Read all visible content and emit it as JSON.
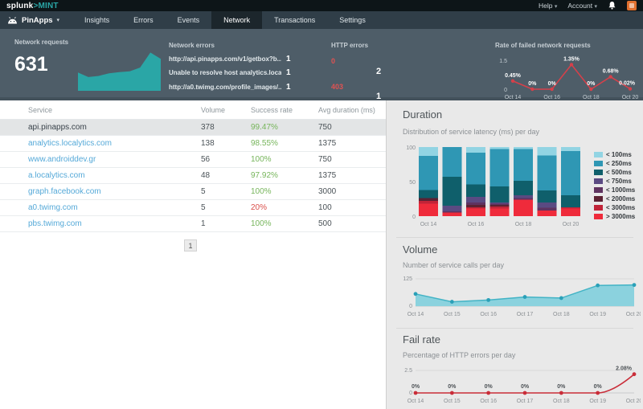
{
  "topbar": {
    "logo_splunk": "splunk",
    "logo_gt": ">",
    "logo_mint": "MINT",
    "help_label": "Help",
    "account_label": "Account"
  },
  "icons": {
    "caret": "▾"
  },
  "nav": {
    "app_label": "PinApps",
    "tabs": [
      {
        "label": "Insights",
        "active": false
      },
      {
        "label": "Errors",
        "active": false
      },
      {
        "label": "Events",
        "active": false
      },
      {
        "label": "Network",
        "active": true
      },
      {
        "label": "Transactions",
        "active": false
      },
      {
        "label": "Settings",
        "active": false
      }
    ]
  },
  "summary": {
    "network_requests": {
      "label": "Network requests",
      "value": "631"
    },
    "network_errors": {
      "label": "Network errors",
      "items": [
        {
          "text": "http://api.pinapps.com/v1/getbox?b...",
          "count": "1"
        },
        {
          "text": "Unable to resolve host analytics.local...",
          "count": "1"
        },
        {
          "text": "http://a0.twimg.com/profile_images/...",
          "count": "1"
        }
      ]
    },
    "http_errors": {
      "label": "HTTP errors",
      "items": [
        {
          "code": "0",
          "count": "2"
        },
        {
          "code": "403",
          "count": "1"
        }
      ]
    },
    "fail_rate_label": "Rate of failed network requests"
  },
  "table": {
    "columns": [
      "Service",
      "Volume",
      "Success rate",
      "Avg duration (ms)"
    ],
    "rows": [
      {
        "service": "api.pinapps.com",
        "volume": "378",
        "success_rate": "99.47%",
        "rate_color": "green",
        "avg_duration": "750",
        "selected": true
      },
      {
        "service": "analytics.localytics.com",
        "volume": "138",
        "success_rate": "98.55%",
        "rate_color": "green",
        "avg_duration": "1375",
        "selected": false
      },
      {
        "service": "www.androiddev.gr",
        "volume": "56",
        "success_rate": "100%",
        "rate_color": "green",
        "avg_duration": "750",
        "selected": false
      },
      {
        "service": "a.localytics.com",
        "volume": "48",
        "success_rate": "97.92%",
        "rate_color": "green",
        "avg_duration": "1375",
        "selected": false
      },
      {
        "service": "graph.facebook.com",
        "volume": "5",
        "success_rate": "100%",
        "rate_color": "green",
        "avg_duration": "3000",
        "selected": false
      },
      {
        "service": "a0.twimg.com",
        "volume": "5",
        "success_rate": "20%",
        "rate_color": "red",
        "avg_duration": "100",
        "selected": false
      },
      {
        "service": "pbs.twimg.com",
        "volume": "1",
        "success_rate": "100%",
        "rate_color": "green",
        "avg_duration": "500",
        "selected": false
      }
    ],
    "pagination": "1"
  },
  "panels": {
    "duration": {
      "title": "Duration",
      "subtitle": "Distribution of service latency (ms) per day"
    },
    "volume": {
      "title": "Volume",
      "subtitle": "Number of service calls per day"
    },
    "fail_rate": {
      "title": "Fail rate",
      "subtitle": "Percentage of HTTP errors per day"
    }
  },
  "chart_data": [
    {
      "id": "network-requests-sparkline",
      "type": "area",
      "values": [
        42,
        30,
        33,
        40,
        43,
        45,
        55,
        95,
        78
      ],
      "color": "#2aa6a6"
    },
    {
      "id": "rate-of-failed-network-requests",
      "type": "line",
      "title": "Rate of failed network requests",
      "x": [
        "Oct 14",
        "Oct 15",
        "Oct 16",
        "Oct 17",
        "Oct 18",
        "Oct 19",
        "Oct 20"
      ],
      "values": [
        0.45,
        0,
        0,
        1.35,
        0,
        0.68,
        0.02
      ],
      "labels": [
        "0.45%",
        "0%",
        "0%",
        "1.35%",
        "0%",
        "0.68%",
        "0.02%"
      ],
      "ylim": [
        0,
        1.5
      ],
      "yticks": [
        "0",
        "1.5"
      ],
      "xticks": [
        "Oct 14",
        "Oct 16",
        "Oct 18",
        "Oct 20"
      ],
      "color": "#d5404a"
    },
    {
      "id": "duration-distribution",
      "type": "bar",
      "stacked": true,
      "title": "Distribution of service latency (ms) per day",
      "categories": [
        "Oct 14",
        "Oct 15",
        "Oct 16",
        "Oct 17",
        "Oct 18",
        "Oct 19",
        "Oct 20"
      ],
      "ylim": [
        0,
        100
      ],
      "yticks": [
        "0",
        "50",
        "100"
      ],
      "xticks": [
        "Oct 14",
        "Oct 16",
        "Oct 18",
        "Oct 20"
      ],
      "stack_note": "last series rendered at bottom of stack",
      "series": [
        {
          "name": "< 100ms",
          "color": "#92d4e3",
          "values": [
            13,
            0,
            8,
            3,
            3,
            12,
            6
          ]
        },
        {
          "name": "< 250ms",
          "color": "#2f97b4",
          "values": [
            49,
            43,
            46,
            54,
            46,
            51,
            64
          ]
        },
        {
          "name": "< 500ms",
          "color": "#0f5f6b",
          "values": [
            12,
            42,
            18,
            23,
            21,
            17,
            17
          ]
        },
        {
          "name": "< 750ms",
          "color": "#5a4a82",
          "values": [
            0,
            8,
            8,
            2,
            4,
            8,
            0
          ]
        },
        {
          "name": "< 1000ms",
          "color": "#5f3360",
          "values": [
            0,
            2,
            4,
            2,
            2,
            4,
            0
          ]
        },
        {
          "name": "< 2000ms",
          "color": "#5c2233",
          "values": [
            4,
            0,
            3,
            2,
            0,
            0,
            0
          ]
        },
        {
          "name": "< 3000ms",
          "color": "#c12438",
          "values": [
            4,
            0,
            2,
            3,
            0,
            0,
            2
          ]
        },
        {
          "name": "> 3000ms",
          "color": "#ef2b3b",
          "values": [
            18,
            5,
            11,
            11,
            24,
            8,
            11
          ]
        }
      ]
    },
    {
      "id": "volume-per-day",
      "type": "area",
      "title": "Number of service calls per day",
      "x": [
        "Oct 14",
        "Oct 15",
        "Oct 16",
        "Oct 17",
        "Oct 18",
        "Oct 19",
        "Oct 20"
      ],
      "values": [
        56,
        20,
        28,
        42,
        37,
        95,
        97
      ],
      "ylim": [
        0,
        125
      ],
      "yticks": [
        "0",
        "125"
      ],
      "fill": "#8bd2de",
      "stroke": "#42b3c5",
      "dot": "#2aa0b8"
    },
    {
      "id": "fail-rate-per-day",
      "type": "line",
      "title": "Percentage of HTTP errors per day",
      "x": [
        "Oct 14",
        "Oct 15",
        "Oct 16",
        "Oct 17",
        "Oct 18",
        "Oct 19",
        "Oct 20"
      ],
      "values": [
        0,
        0,
        0,
        0,
        0,
        0,
        2.08
      ],
      "labels": [
        "0%",
        "0%",
        "0%",
        "0%",
        "0%",
        "0%",
        "2.08%"
      ],
      "ylim": [
        0,
        2.5
      ],
      "yticks": [
        "0",
        "2.5"
      ],
      "color": "#c92d39"
    }
  ],
  "colors": {
    "accent_teal": "#2aa6a6",
    "link_blue": "#55a9d8",
    "success_green": "#76b55b",
    "error_red": "#da4f4a",
    "summary_bg": "#4e5d68",
    "nav_bg": "#303e48",
    "topbar_bg": "#0d1518",
    "panel_bg": "#e9e9e9",
    "badge_orange": "#e0702f"
  }
}
